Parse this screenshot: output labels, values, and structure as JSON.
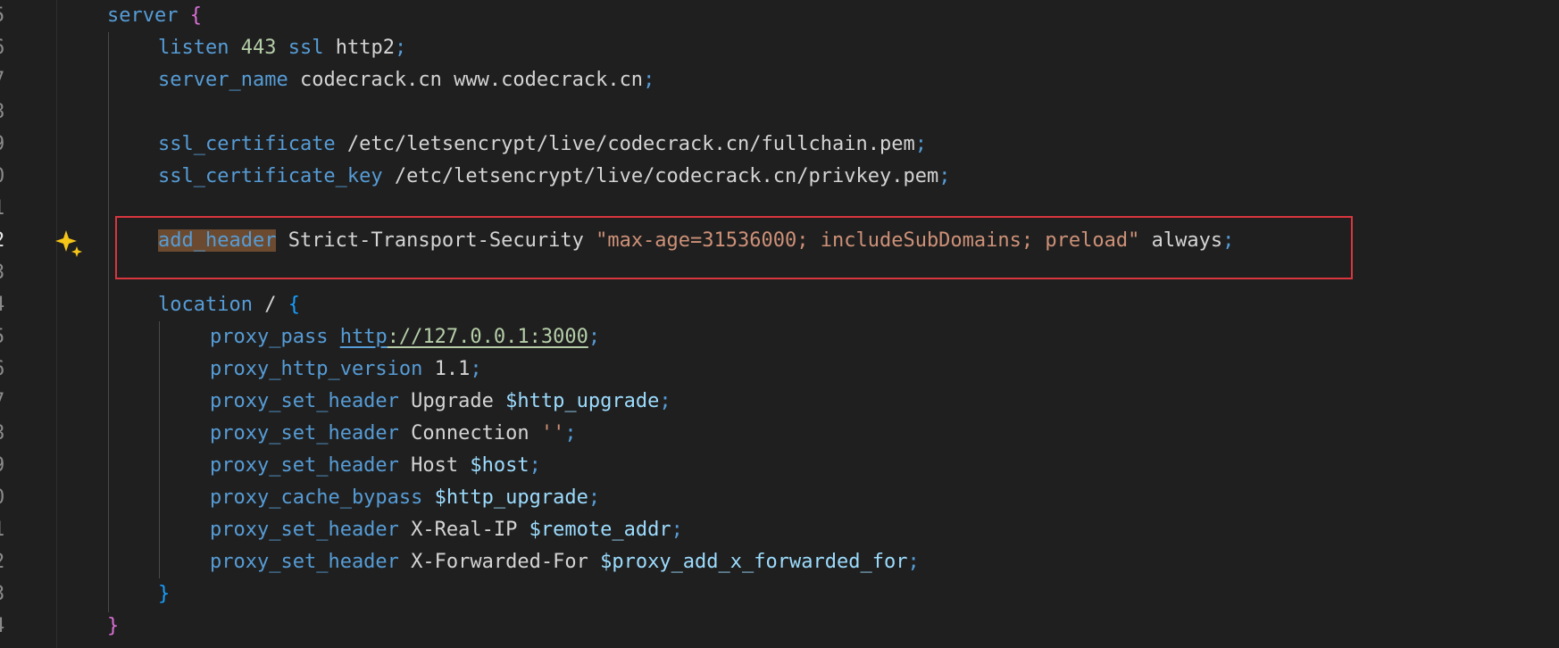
{
  "editor": {
    "line_numbers": [
      "5",
      "6",
      "7",
      "8",
      "9",
      "0",
      "1",
      "2",
      "3",
      "4",
      "5",
      "6",
      "7",
      "8",
      "9",
      "0",
      "1",
      "2",
      "3",
      "4"
    ],
    "lines": [
      {
        "tokens": [
          {
            "c": "kw",
            "t": "server"
          },
          {
            "c": "txt",
            "t": " "
          },
          {
            "c": "brace-p",
            "t": "{"
          }
        ]
      },
      {
        "tokens": [
          {
            "c": "kw",
            "t": "listen"
          },
          {
            "c": "txt",
            "t": " "
          },
          {
            "c": "num",
            "t": "443"
          },
          {
            "c": "txt",
            "t": " "
          },
          {
            "c": "kw",
            "t": "ssl"
          },
          {
            "c": "txt",
            "t": " http2"
          },
          {
            "c": "punct",
            "t": ";"
          }
        ]
      },
      {
        "tokens": [
          {
            "c": "kw",
            "t": "server_name"
          },
          {
            "c": "txt",
            "t": " codecrack.cn www.codecrack.cn"
          },
          {
            "c": "punct",
            "t": ";"
          }
        ]
      },
      {
        "tokens": []
      },
      {
        "tokens": [
          {
            "c": "kw",
            "t": "ssl_certificate"
          },
          {
            "c": "txt",
            "t": " /etc/letsencrypt/live/codecrack.cn/fullchain.pem"
          },
          {
            "c": "punct",
            "t": ";"
          }
        ]
      },
      {
        "tokens": [
          {
            "c": "kw",
            "t": "ssl_certificate_key"
          },
          {
            "c": "txt",
            "t": " /etc/letsencrypt/live/codecrack.cn/privkey.pem"
          },
          {
            "c": "punct",
            "t": ";"
          }
        ]
      },
      {
        "tokens": []
      },
      {
        "tokens": [
          {
            "c": "kw hl",
            "t": "add_header"
          },
          {
            "c": "txt",
            "t": " Strict-Transport-Security "
          },
          {
            "c": "str",
            "t": "\"max-age=31536000; includeSubDomains; preload\""
          },
          {
            "c": "txt",
            "t": " always"
          },
          {
            "c": "punct",
            "t": ";"
          }
        ]
      },
      {
        "tokens": []
      },
      {
        "tokens": [
          {
            "c": "kw",
            "t": "location"
          },
          {
            "c": "txt",
            "t": " / "
          },
          {
            "c": "brace-b",
            "t": "{"
          }
        ]
      },
      {
        "tokens": [
          {
            "c": "kw",
            "t": "proxy_pass"
          },
          {
            "c": "txt",
            "t": " "
          },
          {
            "c": "link-proto",
            "t": "http"
          },
          {
            "c": "link",
            "t": "://127.0.0.1:3000"
          },
          {
            "c": "punct",
            "t": ";"
          }
        ]
      },
      {
        "tokens": [
          {
            "c": "kw",
            "t": "proxy_http_version"
          },
          {
            "c": "txt",
            "t": " 1.1"
          },
          {
            "c": "punct",
            "t": ";"
          }
        ]
      },
      {
        "tokens": [
          {
            "c": "kw",
            "t": "proxy_set_header"
          },
          {
            "c": "txt",
            "t": " Upgrade "
          },
          {
            "c": "var",
            "t": "$http_upgrade"
          },
          {
            "c": "punct",
            "t": ";"
          }
        ]
      },
      {
        "tokens": [
          {
            "c": "kw",
            "t": "proxy_set_header"
          },
          {
            "c": "txt",
            "t": " Connection "
          },
          {
            "c": "str",
            "t": "''"
          },
          {
            "c": "punct",
            "t": ";"
          }
        ]
      },
      {
        "tokens": [
          {
            "c": "kw",
            "t": "proxy_set_header"
          },
          {
            "c": "txt",
            "t": " Host "
          },
          {
            "c": "var",
            "t": "$host"
          },
          {
            "c": "punct",
            "t": ";"
          }
        ]
      },
      {
        "tokens": [
          {
            "c": "kw",
            "t": "proxy_cache_bypass"
          },
          {
            "c": "txt",
            "t": " "
          },
          {
            "c": "var",
            "t": "$http_upgrade"
          },
          {
            "c": "punct",
            "t": ";"
          }
        ]
      },
      {
        "tokens": [
          {
            "c": "kw",
            "t": "proxy_set_header"
          },
          {
            "c": "txt",
            "t": " X-Real-IP "
          },
          {
            "c": "var",
            "t": "$remote_addr"
          },
          {
            "c": "punct",
            "t": ";"
          }
        ]
      },
      {
        "tokens": [
          {
            "c": "kw",
            "t": "proxy_set_header"
          },
          {
            "c": "txt",
            "t": " X-Forwarded-For "
          },
          {
            "c": "var",
            "t": "$proxy_add_x_forwarded_for"
          },
          {
            "c": "punct",
            "t": ";"
          }
        ]
      },
      {
        "tokens": [
          {
            "c": "brace-b",
            "t": "}"
          }
        ]
      },
      {
        "tokens": [
          {
            "c": "brace-p",
            "t": "}"
          }
        ]
      }
    ],
    "active_line_index": 7,
    "gutter_icon": "sparkle-icon",
    "colors": {
      "background": "#1f1f1f",
      "keyword": "#569cd6",
      "string": "#ce9178",
      "number": "#b5cea8",
      "variable": "#9cdcfe",
      "highlight_box": "#d9363e",
      "sparkle": "#f5c518"
    }
  }
}
